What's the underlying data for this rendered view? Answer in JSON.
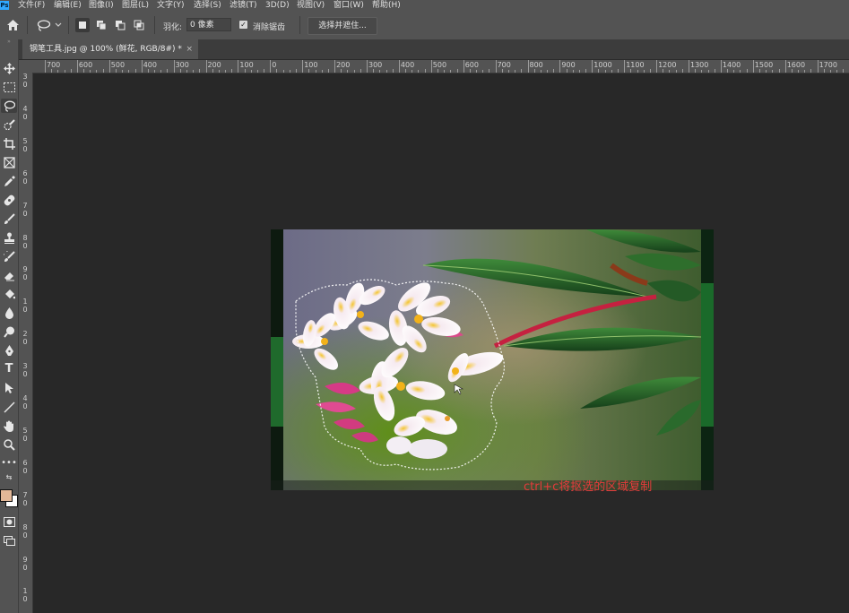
{
  "menubar": {
    "logo": "Ps",
    "items": [
      "文件(F)",
      "编辑(E)",
      "图像(I)",
      "图层(L)",
      "文字(Y)",
      "选择(S)",
      "滤镜(T)",
      "3D(D)",
      "视图(V)",
      "窗口(W)",
      "帮助(H)"
    ]
  },
  "options": {
    "feather_label": "羽化:",
    "feather_value": "0 像素",
    "antialias_label": "消除锯齿",
    "antialias_checked": true,
    "select_mask_label": "选择并遮住..."
  },
  "document": {
    "tab_title": "钢笔工具.jpg @ 100% (鲜花, RGB/8#) *",
    "close_glyph": "×"
  },
  "ruler": {
    "h_labels": [
      "700",
      "600",
      "500",
      "400",
      "300",
      "200",
      "100",
      "0",
      "100",
      "200",
      "300",
      "400",
      "500",
      "600",
      "700",
      "800",
      "900",
      "1000",
      "1100",
      "1200",
      "1300",
      "1400",
      "1500",
      "1600",
      "1700"
    ],
    "v_labels": [
      "3 0",
      "4 0",
      "5 0",
      "6 0",
      "7 0",
      "8 0",
      "9 0",
      "1 0",
      "2 0",
      "3 0",
      "4 0",
      "5 0",
      "6 0",
      "7 0",
      "8 0",
      "9 0",
      "1 0"
    ]
  },
  "toolbar": {
    "icons": [
      "move-icon",
      "marquee-icon",
      "lasso-icon",
      "quick-select-icon",
      "crop-icon",
      "frame-icon",
      "eyedropper-icon",
      "healing-icon",
      "brush-icon",
      "stamp-icon",
      "history-brush-icon",
      "eraser-icon",
      "paint-bucket-icon",
      "blur-icon",
      "dodge-icon",
      "pen-icon",
      "type-icon",
      "path-select-icon",
      "line-icon",
      "hand-icon",
      "zoom-icon",
      "more-icon"
    ],
    "active": "lasso-icon",
    "foreground_color": "#e2b898",
    "background_color": "#ffffff"
  },
  "canvas": {
    "caption": "ctrl+c将抠选的区域复制",
    "caption_color": "#e53b3b"
  }
}
